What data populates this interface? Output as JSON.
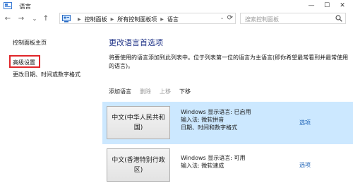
{
  "window": {
    "title": "语言",
    "controls": {
      "minimize": "—",
      "maximize": "☐",
      "close": "✕"
    }
  },
  "nav": {
    "back": "←",
    "forward": "→",
    "history": "⌄",
    "up": "↑",
    "breadcrumbs": [
      "控制面板",
      "所有控制面板项",
      "语言"
    ],
    "separator": "▶",
    "dropdown": "⌄",
    "refresh": "⟳",
    "search_placeholder": "搜索控制面板"
  },
  "sidebar": {
    "items": [
      {
        "label": "控制面板主页"
      },
      {
        "label": "高级设置"
      },
      {
        "label": "更改日期、时间或数字格式"
      }
    ]
  },
  "main": {
    "title": "更改语言首选项",
    "description": "将要使用的语言添加到此列表中。位于列表第一位的语言为主语言(即你希望最常看到并最常使用的语言)。",
    "toolbar": {
      "add": "添加语言",
      "remove": "删除",
      "up": "上移",
      "down": "下移"
    },
    "languages": [
      {
        "name": "中文(中华人民共和国)",
        "display": "Windows 显示语言: 已启用",
        "input": "输入法: 微软拼音",
        "format": "日期、时间和数字格式",
        "options": "选项",
        "selected": true
      },
      {
        "name": "中文(香港特别行政区)",
        "display": "Windows 显示语言: 可用",
        "input": "输入法: 微软速成",
        "options": "选项",
        "selected": false
      }
    ]
  },
  "colors": {
    "accent": "#1e3287",
    "selection": "#cce8ff",
    "link": "#1a5fb4",
    "highlight_box": "#e0262a"
  }
}
